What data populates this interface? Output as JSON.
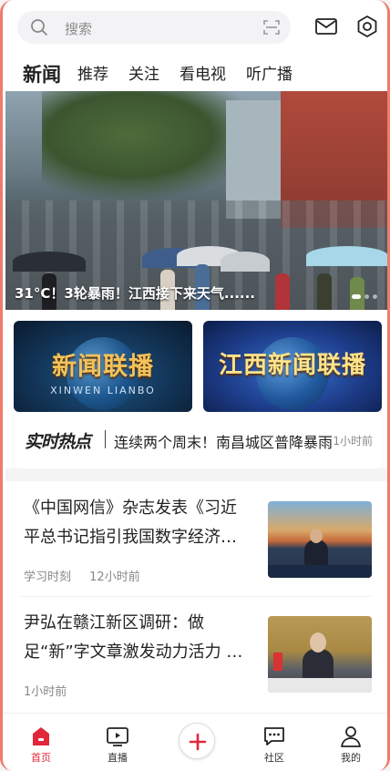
{
  "search": {
    "placeholder": "搜索",
    "icon": "search-icon",
    "scan_icon": "scan-icon"
  },
  "header_icons": [
    {
      "name": "mail-icon"
    },
    {
      "name": "settings-icon"
    }
  ],
  "tabs": [
    {
      "label": "新闻",
      "active": true
    },
    {
      "label": "推荐"
    },
    {
      "label": "关注"
    },
    {
      "label": "看电视"
    },
    {
      "label": "听广播"
    }
  ],
  "hero": {
    "caption": "31°C！3轮暴雨！江西接下来天气......"
  },
  "programs": [
    {
      "title": "新闻联播",
      "subtitle": "XINWEN LIANBO"
    },
    {
      "title": "江西新闻联播",
      "subtitle": ""
    }
  ],
  "hot": {
    "logo": "实时热点",
    "headline": "连续两个周末！南昌城区普降暴雨",
    "time": "1小时前"
  },
  "news": [
    {
      "title": "《中国网信》杂志发表《习近平总书记指引我国数字经济高质量发展纪实》",
      "source": "学习时刻",
      "time": "12小时前"
    },
    {
      "title": "尹弘在赣江新区调研：做足“新”字文章激发动力活力 加快推进高质量发展",
      "source": "",
      "time": "1小时前"
    }
  ],
  "nav": [
    {
      "label": "首页",
      "icon": "home-icon",
      "active": true
    },
    {
      "label": "直播",
      "icon": "live-tv-icon"
    },
    {
      "label": "",
      "icon": "plus-icon"
    },
    {
      "label": "社区",
      "icon": "community-icon"
    },
    {
      "label": "我的",
      "icon": "profile-icon"
    }
  ],
  "colors": {
    "accent": "#e0283a",
    "frame": "#f07b6c",
    "text": "#222222",
    "muted": "#888888"
  }
}
